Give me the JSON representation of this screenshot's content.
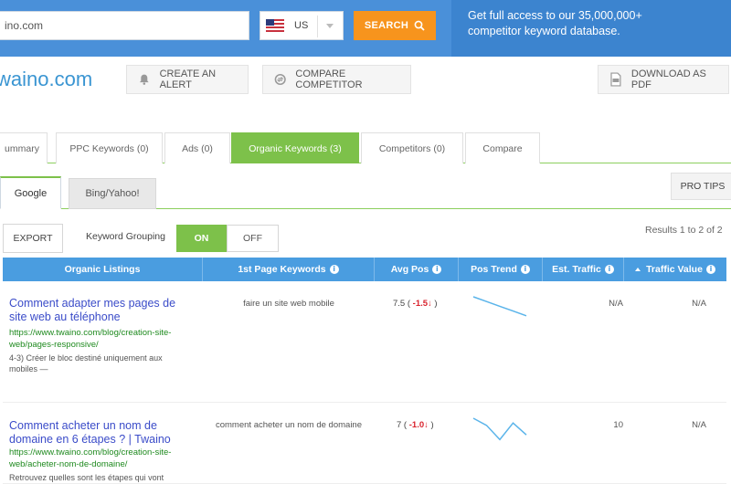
{
  "topbar": {
    "search_value": "ino.com",
    "country": "US",
    "search_label": "SEARCH",
    "promo_line1": "Get full access to our 35,000,000+",
    "promo_line2": "competitor keyword database."
  },
  "header": {
    "site": "waino.com",
    "create_alert": "CREATE AN ALERT",
    "compare_competitor": "COMPARE COMPETITOR",
    "download_pdf": "DOWNLOAD AS PDF"
  },
  "tabs": [
    {
      "label": "ummary"
    },
    {
      "label": "PPC Keywords (0)"
    },
    {
      "label": "Ads (0)"
    },
    {
      "label": "Organic Keywords (3)"
    },
    {
      "label": "Competitors (0)"
    },
    {
      "label": "Compare"
    }
  ],
  "subtabs": {
    "google": "Google",
    "bing": "Bing/Yahoo!",
    "pro_tips": "PRO TIPS"
  },
  "controls": {
    "export": "EXPORT",
    "keyword_grouping": "Keyword Grouping",
    "on": "ON",
    "off": "OFF",
    "results": "Results 1 to 2 of 2"
  },
  "table": {
    "headers": [
      "Organic Listings",
      "1st Page Keywords",
      "Avg Pos",
      "Pos Trend",
      "Est. Traffic",
      "Traffic Value"
    ],
    "rows": [
      {
        "title": "Comment adapter mes pages de site web au téléphone",
        "url": "https://www.twaino.com/blog/creation-site-web/pages-responsive/",
        "desc": "4-3) Créer le bloc destiné uniquement aux mobiles —",
        "keyword": "faire un site web mobile",
        "pos": "7.5",
        "delta": "-1.5",
        "trend": [
          1.0,
          0.8,
          0.6,
          0.4,
          0.2
        ],
        "traffic": "N/A",
        "value": "N/A"
      },
      {
        "title": "Comment acheter un nom de domaine en 6 étapes ? | Twaino",
        "url": "https://www.twaino.com/blog/creation-site-web/acheter-nom-de-domaine/",
        "desc": "Retrouvez quelles sont les étapes qui vont",
        "keyword": "comment acheter un nom de domaine",
        "pos": "7",
        "delta": "-1.0",
        "trend": [
          1.0,
          0.7,
          0.1,
          0.8,
          0.3
        ],
        "traffic": "10",
        "value": "N/A"
      }
    ]
  },
  "colors": {
    "blue": "#4a90d9",
    "orange": "#f7941d",
    "green": "#7dc14a",
    "table_header": "#4a9de0"
  }
}
